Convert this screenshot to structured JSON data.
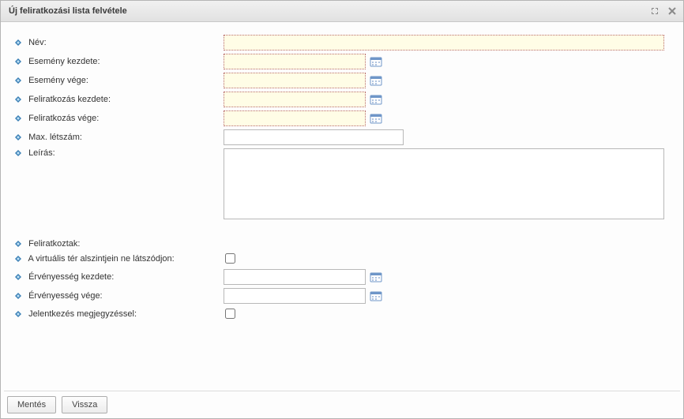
{
  "window": {
    "title": "Új feliratkozási lista felvétele"
  },
  "labels": {
    "name": "Név:",
    "event_start": "Esemény kezdete:",
    "event_end": "Esemény vége:",
    "subscribe_start": "Feliratkozás kezdete:",
    "subscribe_end": "Feliratkozás vége:",
    "max_count": "Max. létszám:",
    "description": "Leírás:",
    "subscribed": "Feliratkoztak:",
    "hide_on_sublevels": "A virtuális tér alszintjein ne látszódjon:",
    "validity_start": "Érvényesség kezdete:",
    "validity_end": "Érvényesség vége:",
    "apply_with_comment": "Jelentkezés megjegyzéssel:"
  },
  "values": {
    "name": "",
    "event_start": "",
    "event_end": "",
    "subscribe_start": "",
    "subscribe_end": "",
    "max_count": "",
    "description": "",
    "validity_start": "",
    "validity_end": ""
  },
  "buttons": {
    "save": "Mentés",
    "back": "Vissza"
  }
}
